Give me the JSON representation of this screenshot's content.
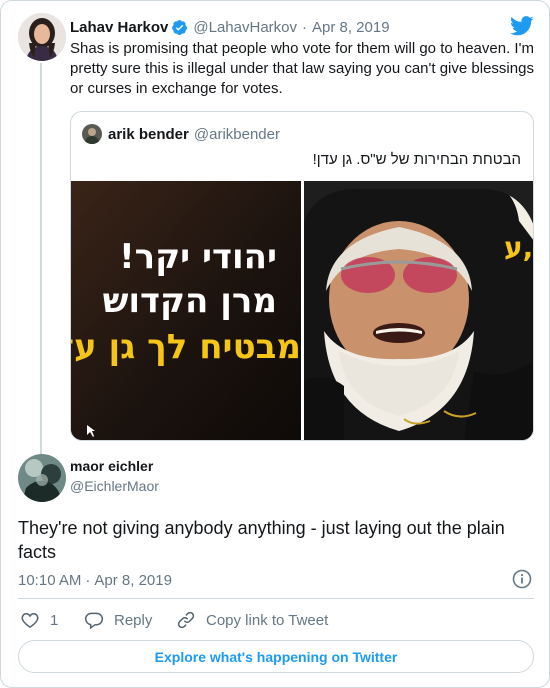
{
  "parent_tweet": {
    "author_name": "Lahav Harkov",
    "handle": "@LahavHarkov",
    "separator": "·",
    "date": "Apr 8, 2019",
    "text": "Shas is promising that people who vote for them will go to heaven. I'm pretty sure this is illegal under that law saying you can't give blessings or curses in exchange for votes."
  },
  "quoted_tweet": {
    "author_name": "arik bender",
    "handle": "@arikbender",
    "text": "הבטחת הבחירות של ש\"ס. גן עדן!",
    "image_left_lines": [
      "יהודי יקר!",
      "מרן הקדוש",
      "מבטיח לך גן עד"
    ],
    "image_right_fragment": "ע,"
  },
  "main_tweet": {
    "author_name": "maor eichler",
    "handle": "@EichlerMaor",
    "text": "They're not giving anybody anything - just laying out the plain facts",
    "time": "10:10 AM",
    "separator": "·",
    "date": "Apr 8, 2019"
  },
  "actions": {
    "like_count": "1",
    "reply_label": "Reply",
    "copy_link_label": "Copy link to Tweet"
  },
  "explore_label": "Explore what's happening on Twitter",
  "colors": {
    "twitter_blue": "#1d9bf0",
    "verified_blue": "#1d9bf0",
    "muted_text": "#657786",
    "border": "#cfd9de",
    "headline_yellow": "#f5c518"
  },
  "icons": {
    "brand": "twitter-bird-icon",
    "verified": "verified-badge-icon",
    "info": "info-icon",
    "like": "heart-icon",
    "reply": "speech-bubble-icon",
    "copy_link": "link-icon"
  }
}
